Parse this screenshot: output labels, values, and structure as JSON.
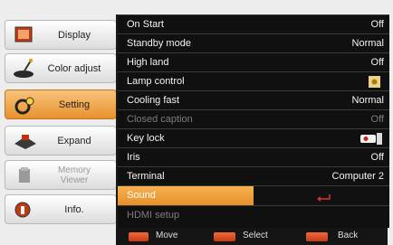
{
  "sidebar": {
    "items": [
      {
        "label": "Display",
        "icon": "display-icon",
        "state": "normal"
      },
      {
        "label": "Color adjust",
        "icon": "color-adjust-icon",
        "state": "normal"
      },
      {
        "label": "Setting",
        "icon": "setting-icon",
        "state": "active"
      },
      {
        "label": "Expand",
        "icon": "expand-icon",
        "state": "normal"
      },
      {
        "label": "Memory\nViewer",
        "icon": "memory-viewer-icon",
        "state": "disabled"
      },
      {
        "label": "Info.",
        "icon": "info-icon",
        "state": "normal"
      }
    ]
  },
  "menu": {
    "rows": [
      {
        "name": "On Start",
        "value": "Off"
      },
      {
        "name": "Standby mode",
        "value": "Normal"
      },
      {
        "name": "High land",
        "value": "Off"
      },
      {
        "name": "Lamp control",
        "value": ""
      },
      {
        "name": "Cooling fast",
        "value": "Normal"
      },
      {
        "name": "Closed caption",
        "value": "Off"
      },
      {
        "name": "Key lock",
        "value": ""
      },
      {
        "name": "Iris",
        "value": "Off"
      },
      {
        "name": "Terminal",
        "value": "Computer 2"
      },
      {
        "name": "Sound",
        "value": ""
      },
      {
        "name": "HDMI setup",
        "value": ""
      }
    ]
  },
  "footer": {
    "move": "Move",
    "select": "Select",
    "back": "Back"
  },
  "colors": {
    "accent": "#e8922e",
    "panel": "#101010",
    "footer_button": "#d9481e"
  }
}
